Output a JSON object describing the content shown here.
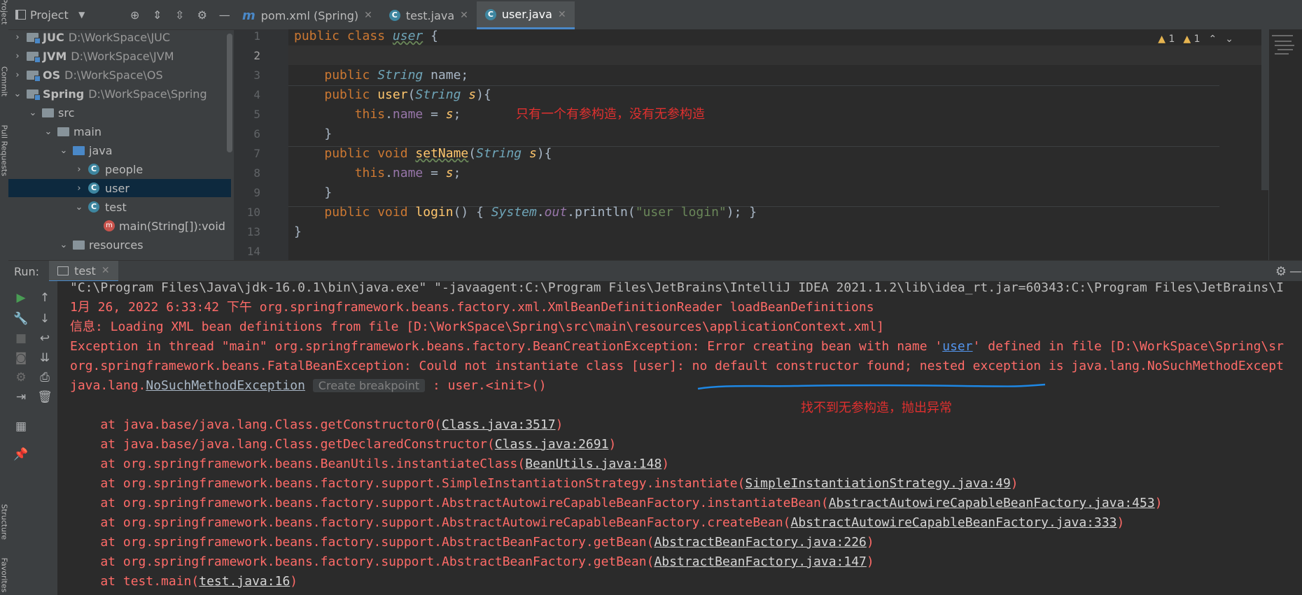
{
  "left_strip": {
    "tabs": [
      "Project",
      "Commit",
      "Pull Requests",
      "Structure",
      "Favorites"
    ]
  },
  "project": {
    "title": "Project",
    "tree": [
      {
        "name": "JUC",
        "path": "D:\\WorkSpace\\JUC"
      },
      {
        "name": "JVM",
        "path": "D:\\WorkSpace\\JVM"
      },
      {
        "name": "OS",
        "path": "D:\\WorkSpace\\OS"
      },
      {
        "name": "Spring",
        "path": "D:\\WorkSpace\\Spring"
      },
      {
        "name": "src"
      },
      {
        "name": "main"
      },
      {
        "name": "java"
      },
      {
        "name": "people"
      },
      {
        "name": "user"
      },
      {
        "name": "test"
      },
      {
        "name": "main(String[]):void"
      },
      {
        "name": "resources"
      }
    ]
  },
  "tabs": [
    {
      "label": "pom.xml (Spring)",
      "icon": "m"
    },
    {
      "label": "test.java",
      "icon": "c"
    },
    {
      "label": "user.java",
      "icon": "C",
      "active": true
    }
  ],
  "editor": {
    "line_numbers": [
      "1",
      "2",
      "3",
      "4",
      "5",
      "6",
      "7",
      "8",
      "9",
      "10",
      "13",
      "14"
    ],
    "warnings": [
      "1",
      "1"
    ],
    "code": {
      "l1a": "public class ",
      "l1b": "user",
      "l1c": " {",
      "l3a": "public ",
      "l3b": "String",
      "l3c": " name;",
      "l4a": "public ",
      "l4b": "user",
      "l4c": "(",
      "l4d": "String",
      "l4e": " s",
      "l4f": "){",
      "l5a": "this",
      "l5b": ".",
      "l5c": "name",
      "l5d": " = ",
      "l5e": "s",
      "l5f": ";",
      "l6": "}",
      "l7a": "public void ",
      "l7b": "setName",
      "l7c": "(",
      "l7d": "String",
      "l7e": " s",
      "l7f": "){",
      "l8a": "this",
      "l8b": ".",
      "l8c": "name",
      "l8d": " = ",
      "l8e": "s",
      "l8f": ";",
      "l9": "}",
      "l10a": "public void ",
      "l10b": "login",
      "l10c": "() { ",
      "l10d": "System",
      "l10e": ".",
      "l10f": "out",
      "l10g": ".println(",
      "l10h": "\"user login\"",
      "l10i": "); }",
      "l13": "}"
    },
    "annotation": "只有一个有参构造，没有无参构造"
  },
  "run": {
    "label": "Run:",
    "tab": "test",
    "lines": {
      "c1": "\"C:\\Program Files\\Java\\jdk-16.0.1\\bin\\java.exe\" \"-javaagent:C:\\Program Files\\JetBrains\\IntelliJ IDEA 2021.1.2\\lib\\idea_rt.jar=60343:C:\\Program Files\\JetBrains\\I",
      "c2": "1月 26, 2022 6:33:42 下午 org.springframework.beans.factory.xml.XmlBeanDefinitionReader loadBeanDefinitions",
      "c3": "信息: Loading XML bean definitions from file [D:\\WorkSpace\\Spring\\src\\main\\resources\\applicationContext.xml]",
      "c4a": "Exception in thread \"main\" org.springframework.beans.factory.BeanCreationException: Error creating bean with name '",
      "c4b": "user",
      "c4c": "' defined in file [D:\\WorkSpace\\Spring\\sr",
      "c5": "org.springframework.beans.FatalBeanException: Could not instantiate class [user]: no default constructor found; nested exception is java.lang.NoSuchMethodExcept",
      "c6a": "java.lang.",
      "c6b": "NoSuchMethodException",
      "c6c": "Create breakpoint",
      "c6d": " : user.<init>()",
      "s1a": "    at java.base/java.lang.Class.getConstructor0(",
      "s1b": "Class.java:3517",
      "s1c": ")",
      "s2a": "    at java.base/java.lang.Class.getDeclaredConstructor(",
      "s2b": "Class.java:2691",
      "s2c": ")",
      "s3a": "    at org.springframework.beans.BeanUtils.instantiateClass(",
      "s3b": "BeanUtils.java:148",
      "s3c": ")",
      "s4a": "    at org.springframework.beans.factory.support.SimpleInstantiationStrategy.instantiate(",
      "s4b": "SimpleInstantiationStrategy.java:49",
      "s4c": ")",
      "s5a": "    at org.springframework.beans.factory.support.AbstractAutowireCapableBeanFactory.instantiateBean(",
      "s5b": "AbstractAutowireCapableBeanFactory.java:453",
      "s5c": ")",
      "s6a": "    at org.springframework.beans.factory.support.AbstractAutowireCapableBeanFactory.createBean(",
      "s6b": "AbstractAutowireCapableBeanFactory.java:333",
      "s6c": ")",
      "s7a": "    at org.springframework.beans.factory.support.AbstractBeanFactory.getBean(",
      "s7b": "AbstractBeanFactory.java:226",
      "s7c": ")",
      "s8a": "    at org.springframework.beans.factory.support.AbstractBeanFactory.getBean(",
      "s8b": "AbstractBeanFactory.java:147",
      "s8c": ")",
      "s9a": "    at test.main(",
      "s9b": "test.java:16",
      "s9c": ")"
    },
    "annotation": "找不到无参构造，抛出异常"
  },
  "colors": {
    "accent": "#4a88c7",
    "error_text": "#ff6b68",
    "annotation_red": "#e0302f",
    "underline_blue": "#1e88e5"
  }
}
